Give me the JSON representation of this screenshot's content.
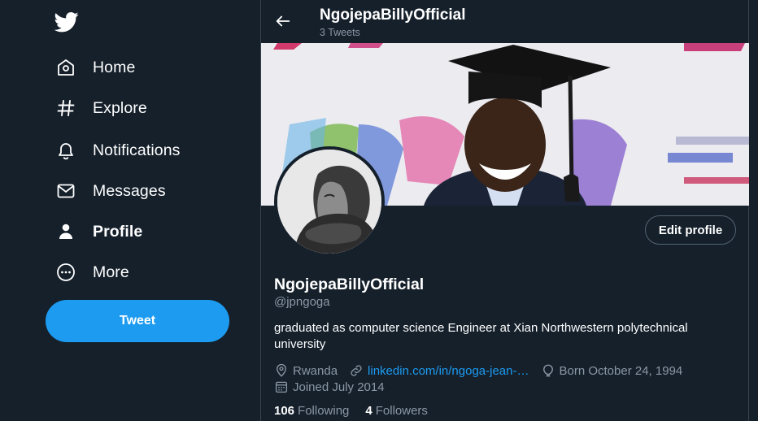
{
  "sidebar": {
    "logo_icon": "twitter-bird-icon",
    "items": [
      {
        "label": "Home",
        "icon": "home-icon"
      },
      {
        "label": "Explore",
        "icon": "hashtag-icon"
      },
      {
        "label": "Notifications",
        "icon": "bell-icon"
      },
      {
        "label": "Messages",
        "icon": "envelope-icon"
      },
      {
        "label": "Profile",
        "icon": "person-icon",
        "active": true
      },
      {
        "label": "More",
        "icon": "more-circle-icon"
      }
    ],
    "tweet_label": "Tweet"
  },
  "header": {
    "name": "NgojepaBillyOfficial",
    "tweet_count": "3 Tweets"
  },
  "profile": {
    "edit_label": "Edit profile",
    "display_name": "NgojepaBillyOfficial",
    "handle": "@jpngoga",
    "bio": "graduated as computer science Engineer at Xian Northwestern polytechnical university",
    "location": "Rwanda",
    "website": "linkedin.com/in/ngoga-jean-…",
    "birthday": "Born October 24, 1994",
    "joined": "Joined July 2014",
    "following_count": "106",
    "following_label": "Following",
    "followers_count": "4",
    "followers_label": "Followers"
  },
  "colors": {
    "background": "#15202b",
    "accent": "#1d9bf0",
    "secondary_text": "#8b98a5"
  }
}
